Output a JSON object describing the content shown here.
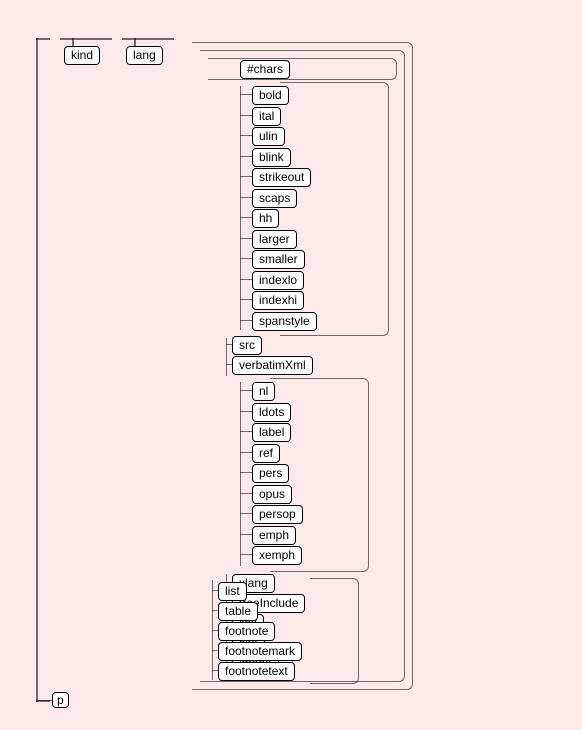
{
  "attrs": {
    "kind": "kind",
    "lang": "lang",
    "leaf": "p"
  },
  "top": {
    "chars": "#chars"
  },
  "group1": [
    "bold",
    "ital",
    "ulin",
    "blink",
    "strikeout",
    "scaps",
    "hh",
    "larger",
    "smaller",
    "indexlo",
    "indexhi",
    "spanstyle"
  ],
  "mid1": [
    "src",
    "verbatimXml"
  ],
  "group2": [
    "nl",
    "ldots",
    "label",
    "ref",
    "pers",
    "opus",
    "persop",
    "emph",
    "xemph"
  ],
  "mid2": [
    "xlang",
    "treeInclude",
    "link",
    "cite",
    "image"
  ],
  "group3": [
    "list",
    "table",
    "footnote",
    "footnotemark",
    "footnotetext"
  ]
}
